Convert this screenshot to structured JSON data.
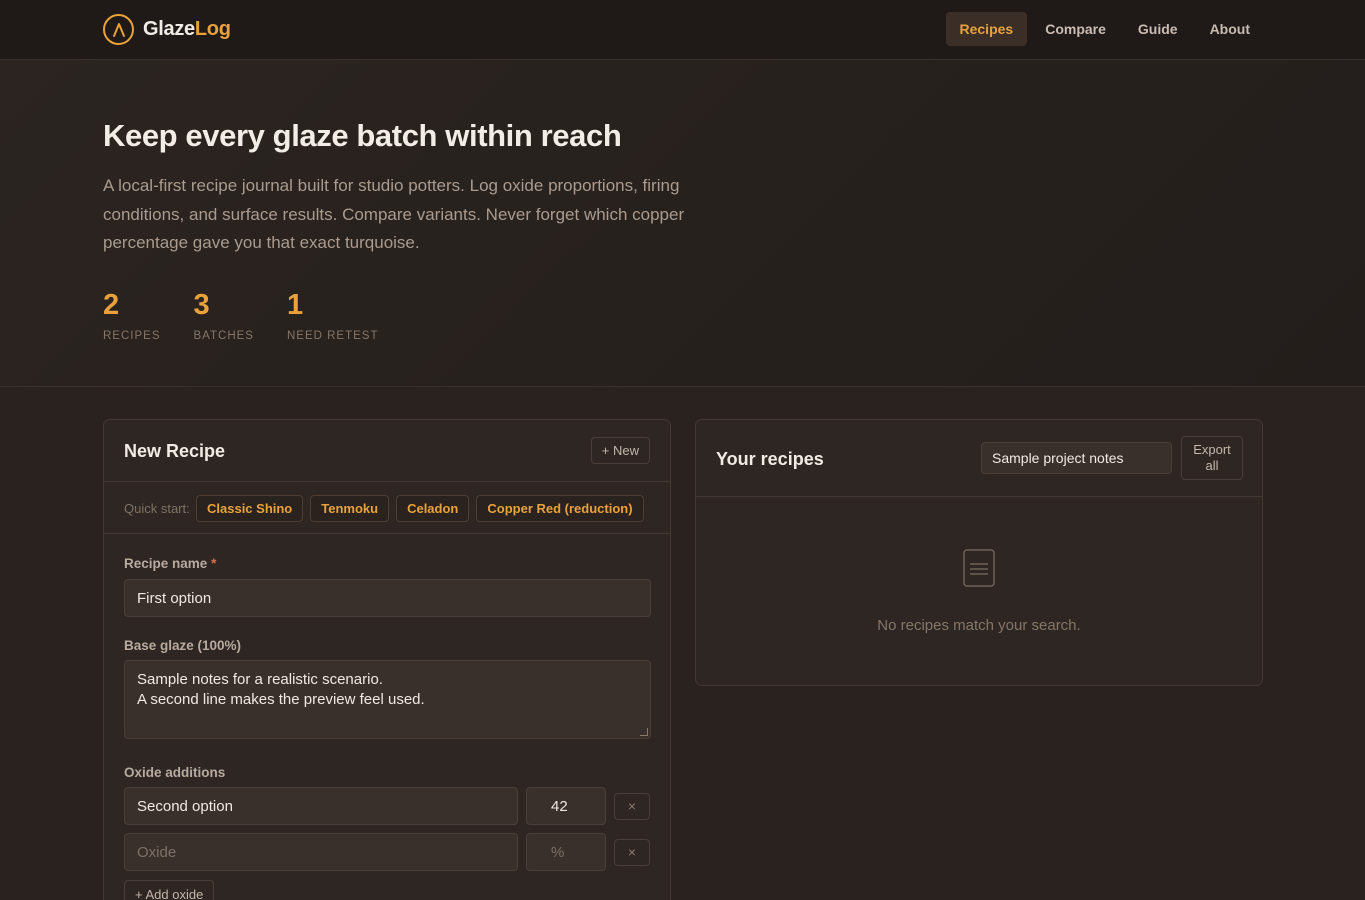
{
  "app": {
    "brand_part1": "Glaze",
    "brand_part2": "Log",
    "accent_color": "#e9a23b"
  },
  "nav": {
    "items": [
      {
        "label": "Recipes",
        "active": true
      },
      {
        "label": "Compare",
        "active": false
      },
      {
        "label": "Guide",
        "active": false
      },
      {
        "label": "About",
        "active": false
      }
    ]
  },
  "hero": {
    "title": "Keep every glaze batch within reach",
    "description": "A local-first recipe journal built for studio potters. Log oxide proportions, firing conditions, and surface results. Compare variants. Never forget which copper percentage gave you that exact turquoise.",
    "stats": [
      {
        "value": "2",
        "label": "RECIPES"
      },
      {
        "value": "3",
        "label": "BATCHES"
      },
      {
        "value": "1",
        "label": "NEED RETEST"
      }
    ]
  },
  "new_recipe": {
    "title": "New Recipe",
    "new_button": "+ New",
    "quick_start_label": "Quick start:",
    "quick_start": [
      "Classic Shino",
      "Tenmoku",
      "Celadon",
      "Copper Red (reduction)"
    ],
    "name_label": "Recipe name",
    "name_required": "*",
    "name_value": "First option",
    "base_label": "Base glaze (100%)",
    "base_value": "Sample notes for a realistic scenario.\nA second line makes the preview feel used.",
    "oxide_label": "Oxide additions",
    "oxides": [
      {
        "name": "Second option",
        "percent": "42",
        "remove": "×"
      }
    ],
    "oxide_placeholder_name": "Oxide",
    "oxide_placeholder_percent": "%",
    "oxide_placeholder_remove": "×",
    "add_oxide": "+ Add oxide"
  },
  "recipe_list": {
    "title": "Your recipes",
    "search_value": "Sample project notes",
    "export_button": "Export all",
    "empty_icon": "document-icon",
    "empty_message": "No recipes match your search."
  }
}
